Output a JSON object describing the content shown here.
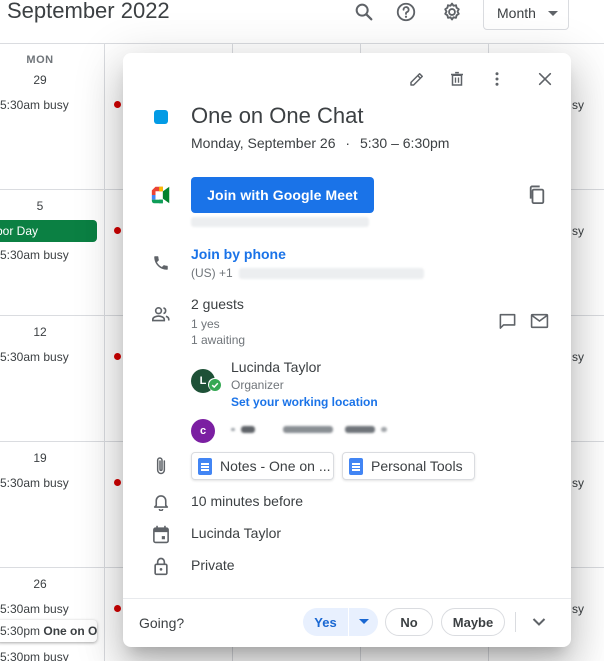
{
  "header": {
    "title": "September 2022",
    "view_label": "Month"
  },
  "grid": {
    "dow_label": "MON",
    "weeks": [
      {
        "day": "29",
        "events": [
          "5:30am busy"
        ]
      },
      {
        "day": "5",
        "holiday": "bor Day",
        "events": [
          "5:30am busy"
        ]
      },
      {
        "day": "12",
        "events": [
          "5:30am busy"
        ]
      },
      {
        "day": "19",
        "events": [
          "5:30am busy"
        ]
      },
      {
        "day": "26",
        "events": [
          "5:30am busy"
        ],
        "active_time": "5:30pm",
        "active_title": "One on On",
        "last_event": "5:30pm busy"
      }
    ],
    "right_busy": [
      "sy",
      "sy",
      "sy",
      "sy",
      "sy"
    ]
  },
  "popup": {
    "title": "One on One Chat",
    "date": "Monday, September 26",
    "time_sep": "·",
    "time": "5:30 – 6:30pm",
    "meet_button": "Join with Google Meet",
    "phone_link": "Join by phone",
    "phone_prefix": "(US) +1",
    "guests_count": "2 guests",
    "guests_yes": "1 yes",
    "guests_awaiting": "1 awaiting",
    "organizer_name": "Lucinda Taylor",
    "organizer_role": "Organizer",
    "organizer_initial": "L",
    "working_location_link": "Set your working location",
    "guest2_initial": "c",
    "attachments": [
      "Notes - One on ...",
      "Personal Tools"
    ],
    "reminder": "10 minutes before",
    "calendar_owner": "Lucinda Taylor",
    "visibility": "Private",
    "rsvp": {
      "prompt": "Going?",
      "yes": "Yes",
      "no": "No",
      "maybe": "Maybe"
    }
  },
  "colors": {
    "event_color": "#039be5",
    "meet_button": "#1a73e8",
    "holiday": "#0b8043",
    "busy_dot": "#d50000",
    "organizer_avatar": "#1e5137",
    "guest_avatar": "#7b1fa2"
  },
  "icons": [
    "search-icon",
    "help-icon",
    "settings-icon",
    "edit-icon",
    "delete-icon",
    "more-icon",
    "close-icon",
    "meet-logo-icon",
    "copy-icon",
    "phone-icon",
    "people-icon",
    "chat-icon",
    "email-icon",
    "attachment-icon",
    "bell-icon",
    "calendar-icon",
    "lock-icon",
    "chevron-down-icon"
  ]
}
